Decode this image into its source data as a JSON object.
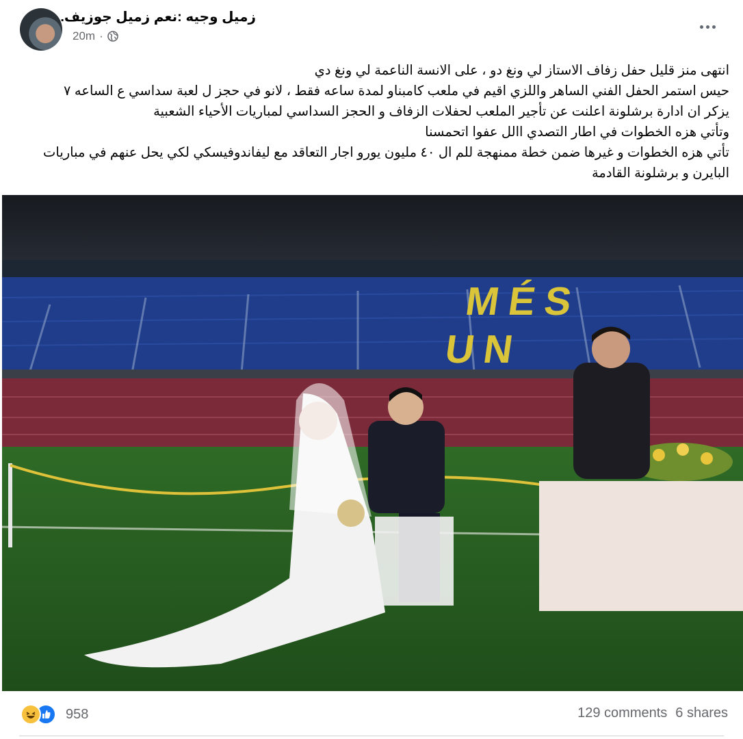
{
  "post": {
    "author": "زميل وجيه :نعم زميل جوزيف.",
    "time": "20m",
    "dot": "·",
    "text_lines": [
      "انتهى منز قليل حفل زفاف الاستاز لي ونغ دو ، على الانسة الناعمة لي ونغ دي",
      "حيس استمر الحفل الفني الساهر واللزي اقيم في ملعب كامبناو لمدة ساعه فقط ، لانو في حجز ل لعبة سداسي ع الساعه ٧",
      "يزكر ان ادارة برشلونة اعلنت عن تأجير الملعب لحفلات الزفاف و الحجز السداسي لمباريات الأحياء الشعبية",
      "وتأتي هزه الخطوات في اطار التصدي االل عفوا اتحمسنا",
      "تأتي هزه الخطوات و غيرها ضمن خطة ممنهجة للم ال ٤٠ مليون يورو اجار التعاقد مع ليفاندوفيسكي لكي يحل عنهم في مباريات البايرن و برشلونة القادمة"
    ],
    "photo": {
      "stand_text": "MÉS QUE UN CLUB"
    }
  },
  "footer": {
    "reaction_count": "958",
    "comments": "129 comments",
    "shares": "6 shares"
  },
  "icons": {
    "globe": "globe-icon",
    "more": "more-icon",
    "haha": "haha-reaction-icon",
    "like": "like-reaction-icon"
  },
  "colors": {
    "secondary_text": "#65676b",
    "like_blue": "#1877f2",
    "haha_yellow": "#f7c03d",
    "pitch_green": "#2d6a25",
    "seat_blue": "#1f3d8a",
    "seat_red": "#7a2a38"
  }
}
